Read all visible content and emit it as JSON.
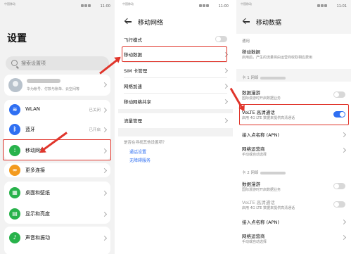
{
  "panel1": {
    "status_left": "中国移动",
    "status_time": "11:00",
    "title": "设置",
    "search_placeholder": "搜索设置项",
    "account_sub": "华为帐号、付款与账单、云空间等",
    "items": [
      {
        "label": "WLAN",
        "value": "已关闭",
        "icon": "wifi-icon",
        "color": "#2f6ff2"
      },
      {
        "label": "蓝牙",
        "value": "已开启",
        "icon": "bluetooth-icon",
        "color": "#2f6ff2"
      },
      {
        "label": "移动网络",
        "value": "",
        "icon": "signal-icon",
        "color": "#28b24b"
      },
      {
        "label": "更多连接",
        "value": "",
        "icon": "link-icon",
        "color": "#f39a1e"
      },
      {
        "label": "桌面和壁纸",
        "value": "",
        "icon": "desktop-icon",
        "color": "#28b24b"
      },
      {
        "label": "显示和亮度",
        "value": "",
        "icon": "display-icon",
        "color": "#28b24b"
      },
      {
        "label": "声音和振动",
        "value": "",
        "icon": "sound-icon",
        "color": "#28b24b"
      }
    ]
  },
  "panel2": {
    "status_time": "11:00",
    "title": "移动网络",
    "items": [
      {
        "label": "飞行模式"
      },
      {
        "label": "移动数据"
      },
      {
        "label": "SIM 卡管理"
      },
      {
        "label": "网络加速"
      },
      {
        "label": "移动网络共享"
      },
      {
        "label": "流量管理"
      }
    ],
    "hint": "是否在寻找其他设置项？",
    "links": [
      "通话设置",
      "无障碍服务"
    ]
  },
  "panel3": {
    "status_time": "11:01",
    "title": "移动数据",
    "general_header": "通用",
    "mobile_data_title": "移动数据",
    "mobile_data_sub": "启用后，产生的流量将由运营商收取相应费用",
    "sim1_header": "卡 1 网络",
    "sim2_header": "卡 2 网络",
    "roaming_title": "数据漫游",
    "roaming_sub": "国际漫游时开启数据业务",
    "volte_title": "VoLTE 高清通话",
    "volte_sub": "启用 4G LTE 数据来提供高清通话",
    "apn_title": "接入点名称 (APN)",
    "carrier_title": "网络运营商",
    "carrier_sub": "手动或自动选择"
  },
  "colors": {
    "accent": "#2f6ff2",
    "highlight": "#e0352b"
  }
}
